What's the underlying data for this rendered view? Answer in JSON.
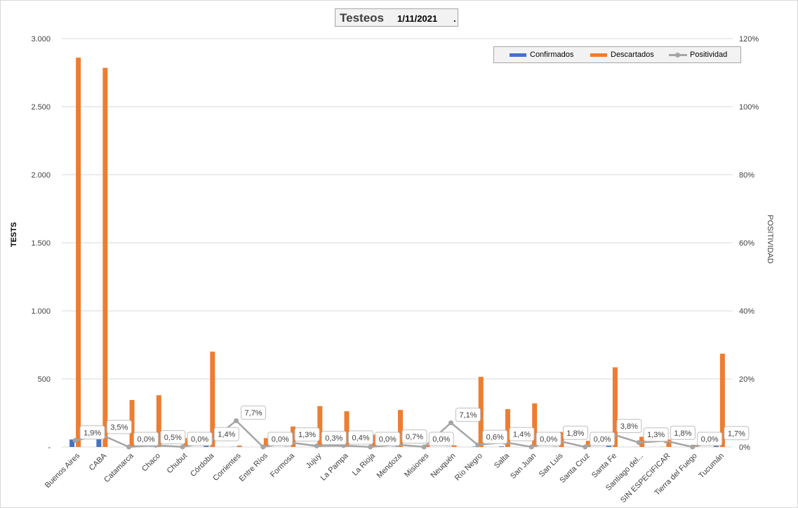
{
  "chart_data": {
    "type": "bar",
    "title": "Testeos",
    "date": "1/11/2021",
    "title_suffix": ".",
    "ylabel": "TESTS",
    "y2label": "POSITIVIDAD",
    "ylim": [
      0,
      3000
    ],
    "y2lim": [
      0,
      120
    ],
    "y_ticks": [
      "-",
      "500",
      "1.000",
      "1.500",
      "2.000",
      "2.500",
      "3.000"
    ],
    "y2_ticks": [
      "0%",
      "20%",
      "40%",
      "60%",
      "80%",
      "100%",
      "120%"
    ],
    "grid": true,
    "legend_position": "top-right",
    "colors": {
      "confirmados": "#4472c4",
      "descartados": "#ed7d31",
      "positividad": "#a5a5a5"
    },
    "categories": [
      "Buenos Aires",
      "CABA",
      "Catamarca",
      "Chaco",
      "Chubut",
      "Córdoba",
      "Corrientes",
      "Entre Ríos",
      "Formosa",
      "Jujuy",
      "La Pampa",
      "La Rioja",
      "Mendoza",
      "Misiones",
      "Neuquén",
      "Río Negro",
      "Salta",
      "San Juan",
      "San Luis",
      "Santa Cruz",
      "Santa Fe",
      "Santiago del...",
      "SIN ESPECIFICAR",
      "Tierra del Fuego",
      "Tucumán"
    ],
    "series": [
      {
        "name": "Confirmados",
        "kind": "bar",
        "axis": "left",
        "values": [
          55,
          100,
          0,
          2,
          0,
          10,
          1,
          0,
          2,
          1,
          1,
          0,
          2,
          0,
          1,
          3,
          4,
          0,
          2,
          0,
          23,
          1,
          1,
          0,
          12
        ]
      },
      {
        "name": "Descartados",
        "kind": "bar",
        "axis": "left",
        "values": [
          2860,
          2785,
          345,
          380,
          65,
          700,
          10,
          65,
          150,
          300,
          262,
          90,
          272,
          15,
          12,
          515,
          278,
          320,
          110,
          45,
          585,
          75,
          55,
          15,
          685
        ]
      },
      {
        "name": "Positividad",
        "kind": "line",
        "axis": "right",
        "values": [
          1.9,
          3.5,
          0.0,
          0.5,
          0.0,
          1.4,
          7.7,
          0.0,
          1.3,
          0.3,
          0.4,
          0.0,
          0.7,
          0.0,
          7.1,
          0.6,
          1.4,
          0.0,
          1.8,
          0.0,
          3.8,
          1.3,
          1.8,
          0.0,
          1.7
        ],
        "labels": [
          "1,9%",
          "3,5%",
          "0,0%",
          "0,5%",
          "0,0%",
          "1,4%",
          "7,7%",
          "0,0%",
          "1,3%",
          "0,3%",
          "0,4%",
          "0,0%",
          "0,7%",
          "0,0%",
          "7,1%",
          "0,6%",
          "1,4%",
          "0,0%",
          "1,8%",
          "0,0%",
          "3,8%",
          "1,3%",
          "1,8%",
          "0,0%",
          "1,7%"
        ]
      }
    ]
  }
}
